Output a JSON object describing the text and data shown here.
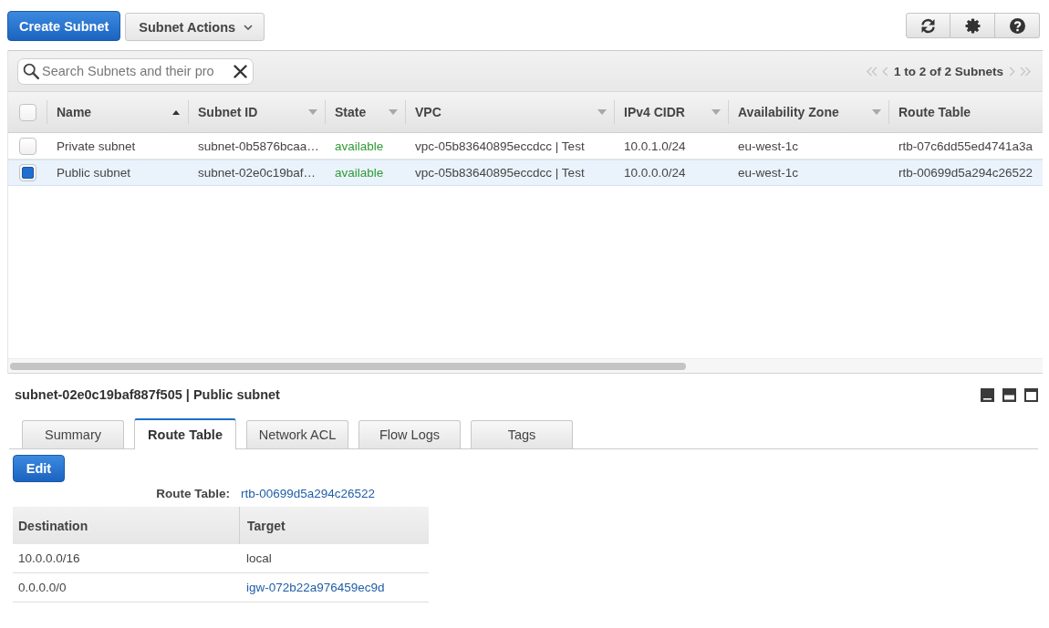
{
  "toolbar": {
    "create_button": "Create Subnet",
    "actions_button": "Subnet Actions"
  },
  "search": {
    "placeholder": "Search Subnets and their pro"
  },
  "pagination": {
    "label": "1 to 2 of 2 Subnets"
  },
  "table": {
    "all_checked": false,
    "columns": [
      {
        "label": "Name",
        "kind": "sorted"
      },
      {
        "label": "Subnet ID",
        "kind": "sortable"
      },
      {
        "label": "State",
        "kind": "sortable"
      },
      {
        "label": "VPC",
        "kind": "sortable"
      },
      {
        "label": "IPv4 CIDR",
        "kind": "sortable"
      },
      {
        "label": "Availability Zone",
        "kind": "sortable"
      },
      {
        "label": "Route Table",
        "kind": "plain"
      }
    ],
    "rows": [
      {
        "selected": false,
        "name": "Private subnet",
        "subnet_id": "subnet-0b5876bcaa…",
        "status": "available",
        "vpc": "vpc-05b83640895eccdcc | Test",
        "ipv4_cidr": "10.0.1.0/24",
        "availability_zone": "eu-west-1c",
        "route_table": "rtb-07c6dd55ed4741a3a"
      },
      {
        "selected": true,
        "name": "Public subnet",
        "subnet_id": "subnet-02e0c19baf…",
        "status": "available",
        "vpc": "vpc-05b83640895eccdcc | Test",
        "ipv4_cidr": "10.0.0.0/24",
        "availability_zone": "eu-west-1c",
        "route_table": "rtb-00699d5a294c26522"
      }
    ]
  },
  "detail": {
    "title": "subnet-02e0c19baf887f505 | Public subnet",
    "tabs": [
      {
        "label": "Summary",
        "selected": false
      },
      {
        "label": "Route Table",
        "selected": true
      },
      {
        "label": "Network ACL",
        "selected": false
      },
      {
        "label": "Flow Logs",
        "selected": false
      },
      {
        "label": "Tags",
        "selected": false
      }
    ],
    "edit_button": "Edit",
    "route_table": {
      "label": "Route Table:",
      "link": "rtb-00699d5a294c26522"
    },
    "routes": {
      "columns": [
        "Destination",
        "Target"
      ],
      "rows": [
        {
          "destination": "10.0.0.0/16",
          "target": "local",
          "target_link": false
        },
        {
          "destination": "0.0.0.0/0",
          "target": "igw-072b22a976459ec9d",
          "target_link": true
        }
      ]
    }
  }
}
